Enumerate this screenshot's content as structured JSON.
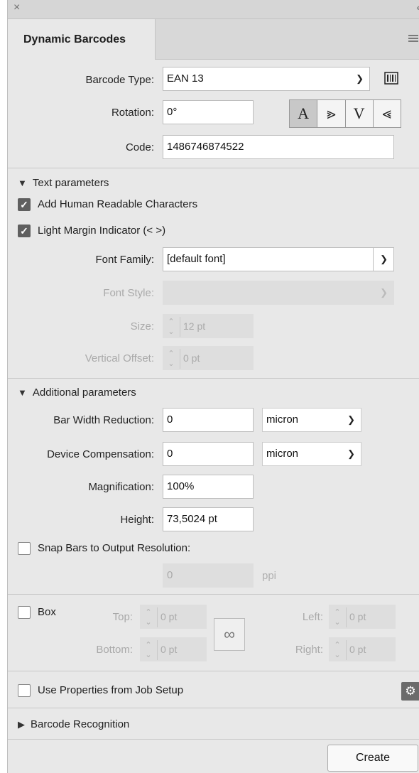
{
  "window": {
    "close_glyph": "×",
    "collapse_glyph": "‹‹"
  },
  "tab": {
    "title": "Dynamic Barcodes"
  },
  "barcode_type": {
    "label": "Barcode Type:",
    "value": "EAN 13"
  },
  "rotation": {
    "label": "Rotation:",
    "value": "0°",
    "buttons": [
      "A",
      "⪢",
      "V",
      "⪡"
    ],
    "active_index": 0
  },
  "code": {
    "label": "Code:",
    "value": "1486746874522"
  },
  "text_parameters": {
    "title": "Text parameters",
    "add_hrc": {
      "label": "Add Human Readable Characters",
      "checked": true
    },
    "light_margin": {
      "label": "Light Margin Indicator (< >)",
      "checked": true
    },
    "font_family": {
      "label": "Font Family:",
      "value": "[default font]"
    },
    "font_style": {
      "label": "Font Style:",
      "value": ""
    },
    "size": {
      "label": "Size:",
      "value": "12 pt"
    },
    "vertical_offset": {
      "label": "Vertical Offset:",
      "value": "0 pt"
    }
  },
  "additional_parameters": {
    "title": "Additional parameters",
    "bar_width_reduction": {
      "label": "Bar Width Reduction:",
      "value": "0",
      "unit": "micron"
    },
    "device_compensation": {
      "label": "Device Compensation:",
      "value": "0",
      "unit": "micron"
    },
    "magnification": {
      "label": "Magnification:",
      "value": "100%"
    },
    "height": {
      "label": "Height:",
      "value": "73,5024 pt"
    },
    "snap_bars": {
      "label": "Snap Bars to Output Resolution:",
      "checked": false,
      "value": "0",
      "unit": "ppi"
    }
  },
  "box": {
    "label": "Box",
    "checked": false,
    "top": {
      "label": "Top:",
      "value": "0 pt"
    },
    "bottom": {
      "label": "Bottom:",
      "value": "0 pt"
    },
    "left": {
      "label": "Left:",
      "value": "0 pt"
    },
    "right": {
      "label": "Right:",
      "value": "0 pt"
    }
  },
  "job_setup": {
    "label": "Use Properties from Job Setup",
    "checked": false
  },
  "barcode_recognition": {
    "title": "Barcode Recognition"
  },
  "create_button": {
    "label": "Create"
  }
}
